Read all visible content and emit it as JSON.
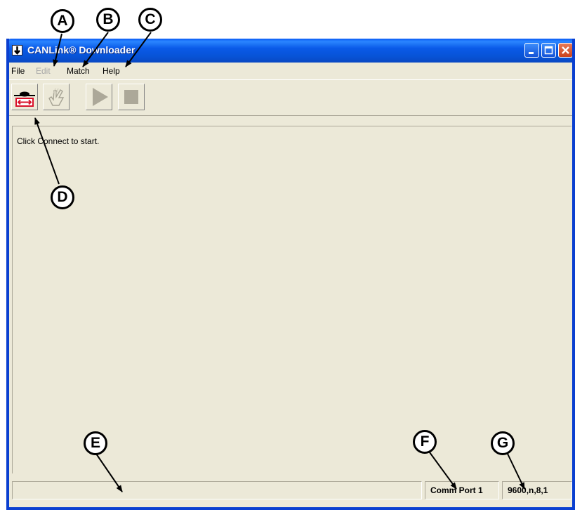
{
  "window": {
    "title": "CANLink® Downloader"
  },
  "menu": {
    "file": "File",
    "edit": "Edit",
    "match": "Match",
    "help": "Help"
  },
  "content": {
    "status_message": "Click Connect to start."
  },
  "statusbar": {
    "main_text": "",
    "port": "Comm Port 1",
    "baud": "9600,n,8,1"
  },
  "callouts": {
    "a": "A",
    "b": "B",
    "c": "C",
    "d": "D",
    "e": "E",
    "f": "F",
    "g": "G"
  },
  "icons": [
    "app-icon",
    "minimize-icon",
    "maximize-icon",
    "close-icon",
    "connect-icon",
    "select-icon",
    "play-icon",
    "stop-icon"
  ],
  "colors": {
    "titlebar": "#0753d6",
    "close": "#c9431c",
    "connect_red": "#d8102a",
    "window_bg": "#ece9d8"
  }
}
